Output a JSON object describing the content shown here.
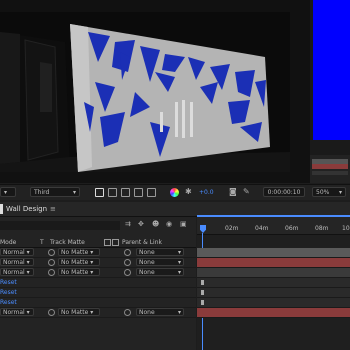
{
  "viewer": {
    "resolution": "Third",
    "exposure": "+0.0",
    "timecode": "0:00:00:10",
    "zoom": "50%"
  },
  "timeline": {
    "comp_tab": "Wall Design",
    "columns": {
      "mode": "Mode",
      "t": "T",
      "track_matte": "Track Matte",
      "parent": "Parent & Link"
    },
    "ruler": [
      "02m",
      "04m",
      "06m",
      "08m",
      "10"
    ],
    "rows": [
      {
        "mode": "Normal",
        "matte": "No Matte",
        "parent": "None",
        "type": "layer"
      },
      {
        "mode": "Normal",
        "matte": "No Matte",
        "parent": "None",
        "type": "layer"
      },
      {
        "mode": "Normal",
        "matte": "No Matte",
        "parent": "None",
        "type": "layer"
      },
      {
        "label": "Reset",
        "type": "prop"
      },
      {
        "label": "Reset",
        "type": "prop"
      },
      {
        "label": "Reset",
        "type": "prop"
      },
      {
        "mode": "Normal",
        "matte": "No Matte",
        "parent": "None",
        "type": "layer"
      }
    ]
  },
  "colors": {
    "blue_preview": "#0000ff",
    "track_red": "#8a3b3b",
    "playhead": "#4a8cff"
  }
}
